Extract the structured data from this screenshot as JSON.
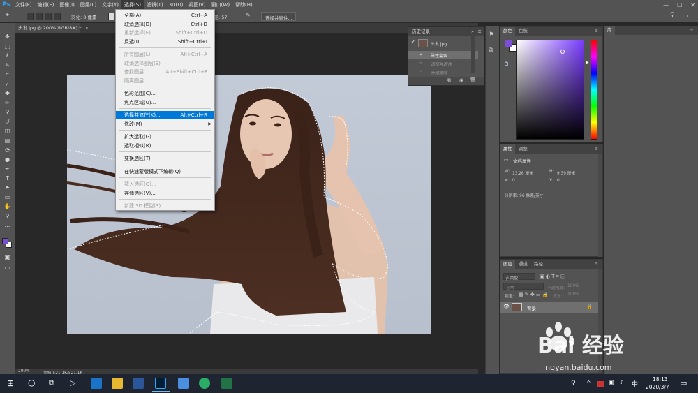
{
  "app": {
    "logo": "Ps"
  },
  "menubar": {
    "items": [
      "文件(F)",
      "编辑(E)",
      "图像(I)",
      "图层(L)",
      "文字(Y)",
      "选择(S)",
      "滤镜(T)",
      "3D(D)",
      "视图(V)",
      "窗口(W)",
      "帮助(H)"
    ],
    "active_index": 5
  },
  "options_bar": {
    "feather_label": "羽化: 0 像素",
    "tolerance_label": "容差: 57",
    "select_mask_button": "选择并遮住..."
  },
  "document_tab": {
    "label": "头发.jpg @ 200%(RGB/8#) *",
    "close": "×"
  },
  "status_bar": {
    "zoom": "200%",
    "doc_info": "文档:521.1K/521.1K"
  },
  "select_menu": {
    "items": [
      {
        "label": "全部(A)",
        "shortcut": "Ctrl+A",
        "disabled": false
      },
      {
        "label": "取消选择(D)",
        "shortcut": "Ctrl+D",
        "disabled": false
      },
      {
        "label": "重新选择(E)",
        "shortcut": "Shift+Ctrl+D",
        "disabled": true
      },
      {
        "label": "反选(I)",
        "shortcut": "Shift+Ctrl+I",
        "disabled": false
      },
      {
        "label": "所有图层(L)",
        "shortcut": "Alt+Ctrl+A",
        "disabled": true
      },
      {
        "label": "取消选择图层(S)",
        "shortcut": "",
        "disabled": true
      },
      {
        "label": "查找图层",
        "shortcut": "Alt+Shift+Ctrl+F",
        "disabled": true
      },
      {
        "label": "隔离图层",
        "shortcut": "",
        "disabled": true
      },
      {
        "label": "色彩范围(C)...",
        "shortcut": "",
        "disabled": false
      },
      {
        "label": "焦点区域(U)...",
        "shortcut": "",
        "disabled": false
      },
      {
        "label": "选择并遮住(K)...",
        "shortcut": "Alt+Ctrl+R",
        "disabled": false,
        "highlighted": true
      },
      {
        "label": "修改(M)",
        "shortcut": "",
        "disabled": false,
        "submenu": true
      },
      {
        "label": "扩大选取(G)",
        "shortcut": "",
        "disabled": false
      },
      {
        "label": "选取相似(R)",
        "shortcut": "",
        "disabled": false
      },
      {
        "label": "变换选区(T)",
        "shortcut": "",
        "disabled": false
      },
      {
        "label": "在快速蒙版模式下编辑(Q)",
        "shortcut": "",
        "disabled": false
      },
      {
        "label": "载入选区(O)...",
        "shortcut": "",
        "disabled": true
      },
      {
        "label": "存储选区(V)...",
        "shortcut": "",
        "disabled": false
      },
      {
        "label": "新建 3D 模型(3)",
        "shortcut": "",
        "disabled": true
      }
    ]
  },
  "history_panel": {
    "title": "历史记录",
    "snapshot": "头发.jpg",
    "states": [
      "磁性套索",
      "选择并遮住",
      "新建图层"
    ]
  },
  "color_panel": {
    "tabs": [
      "颜色",
      "色板"
    ],
    "foreground": "#7b4fd6",
    "background": "#ffffff",
    "hue_color": "#7a3cff"
  },
  "properties_panel": {
    "tabs": [
      "属性",
      "调整"
    ],
    "title": "文档属性",
    "w_label": "W:",
    "w_value": "13.26 厘米",
    "h_label": "H:",
    "h_value": "9.39 厘米",
    "x_label": "X:",
    "x_value": "0",
    "y_label": "Y:",
    "y_value": "0",
    "resolution": "分辨率: 96 像素/英寸"
  },
  "layers_panel": {
    "tabs": [
      "图层",
      "通道",
      "路径"
    ],
    "filter_kind": "ρ 类型",
    "blend_mode": "正常",
    "opacity_label": "不透明度:",
    "opacity_value": "100%",
    "lock_label": "锁定:",
    "fill_label": "填充:",
    "fill_value": "100%",
    "layer_name": "背景"
  },
  "library_panel": {
    "tab": "库"
  },
  "taskbar": {
    "time": "18:13",
    "date": "2020/3/7",
    "ime": "中"
  },
  "watermark": {
    "text": "Bai 经验",
    "url": "jingyan.baidu.com"
  }
}
